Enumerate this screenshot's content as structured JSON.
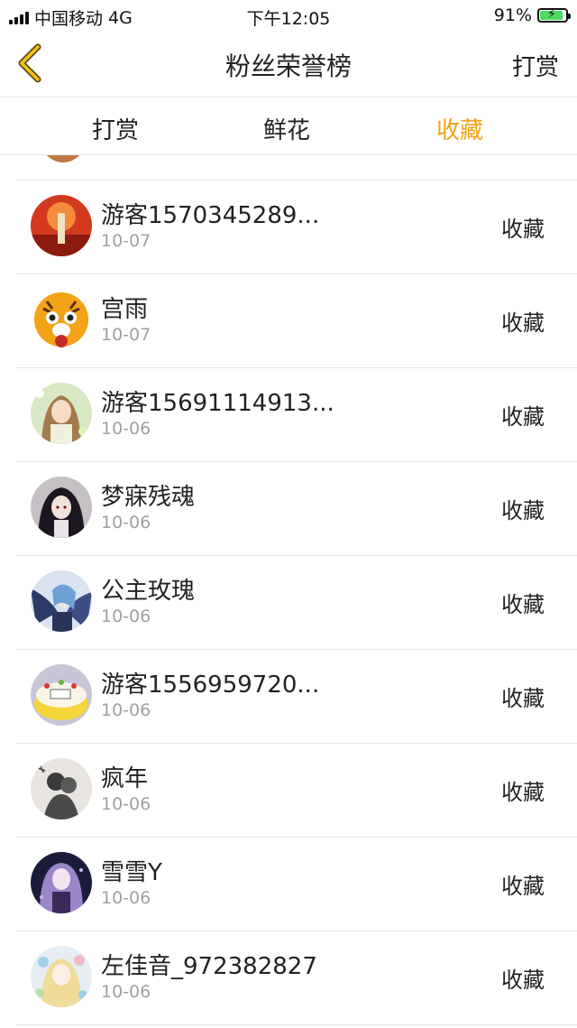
{
  "status": {
    "carrier": "中国移动",
    "network": "4G",
    "time": "下午12:05",
    "battery": "91%",
    "battery_level": 0.91
  },
  "nav": {
    "title": "粉丝荣誉榜",
    "right": "打赏"
  },
  "tabs": [
    {
      "label": "打赏",
      "active": false
    },
    {
      "label": "鲜花",
      "active": false
    },
    {
      "label": "收藏",
      "active": true
    }
  ],
  "colors": {
    "accent": "#f3a316",
    "date": "#a0a0a0",
    "divider": "#e6e6e6"
  },
  "items": [
    {
      "name": "游客1570345289...",
      "date": "10-07",
      "action": "收藏",
      "avatar": "red-landscape-avatar"
    },
    {
      "name": "宫雨",
      "date": "10-07",
      "action": "收藏",
      "avatar": "tiger-avatar"
    },
    {
      "name": "游客15691114913...",
      "date": "10-06",
      "action": "收藏",
      "avatar": "anime-girl-avatar"
    },
    {
      "name": "梦寐残魂",
      "date": "10-06",
      "action": "收藏",
      "avatar": "dark-hair-girl-avatar"
    },
    {
      "name": "公主玫瑰",
      "date": "10-06",
      "action": "收藏",
      "avatar": "blue-wings-avatar"
    },
    {
      "name": "游客1556959720...",
      "date": "10-06",
      "action": "收藏",
      "avatar": "cake-avatar"
    },
    {
      "name": "疯年",
      "date": "10-06",
      "action": "收藏",
      "avatar": "couple-sketch-avatar"
    },
    {
      "name": "雪雪Y",
      "date": "10-06",
      "action": "收藏",
      "avatar": "purple-hair-girl-avatar"
    },
    {
      "name": "左佳音_972382827",
      "date": "10-06",
      "action": "收藏",
      "avatar": "flower-girl-avatar"
    }
  ]
}
